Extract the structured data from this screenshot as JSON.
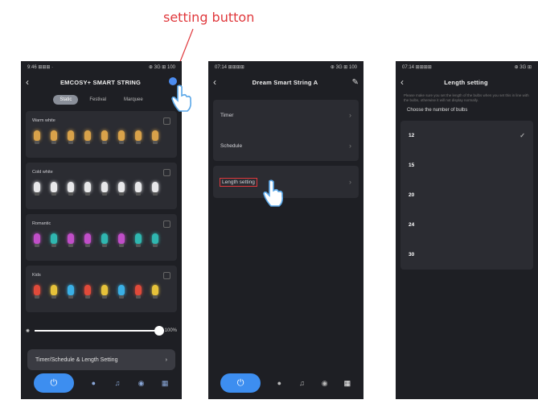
{
  "annotation": {
    "label": "setting button",
    "color": "#e0383c"
  },
  "screen1": {
    "status_left": "9:46 ⊞⊞⊞ ·",
    "status_right": "⊕ 3G ⊞ 100",
    "title": "EMCOSY+ SMART STRING",
    "tabs": [
      "Static",
      "Festival",
      "Marquee"
    ],
    "active_tab": "Static",
    "cards": [
      {
        "label": "Warm white",
        "colors": [
          "#d9a24a",
          "#d9a24a",
          "#d9a24a",
          "#d9a24a",
          "#d9a24a",
          "#d9a24a",
          "#d9a24a",
          "#d9a24a"
        ]
      },
      {
        "label": "Cold white",
        "colors": [
          "#e8e8ea",
          "#e8e8ea",
          "#e8e8ea",
          "#e8e8ea",
          "#e8e8ea",
          "#e8e8ea",
          "#e8e8ea",
          "#e8e8ea"
        ]
      },
      {
        "label": "Romantic",
        "colors": [
          "#c04ec8",
          "#2fb7b0",
          "#c04ec8",
          "#c04ec8",
          "#2fb7b0",
          "#c04ec8",
          "#2fb7b0",
          "#2fb7b0"
        ]
      },
      {
        "label": "Kids",
        "colors": [
          "#e04a3a",
          "#e6c23a",
          "#3ab0e6",
          "#e04a3a",
          "#e6c23a",
          "#3ab0e6",
          "#e04a3a",
          "#e6c23a"
        ]
      }
    ],
    "brightness_value": "100%",
    "bottom_button": "Timer/Schedule & Length Setting",
    "accent": "#3d8ef0"
  },
  "screen2": {
    "status_left": "07:14 ⊞⊞⊞⊞",
    "status_right": "⊕ 3G ⊞ 100",
    "title": "Dream Smart String A",
    "items_group": [
      "Timer",
      "Schedule"
    ],
    "length_item": "Length setting",
    "highlight_color": "#e0383c"
  },
  "screen3": {
    "status_left": "07:14 ⊞⊞⊞⊞",
    "status_right": "⊕ 3G ⊞",
    "title": "Length setting",
    "description": "Please make sure you set the length of the bulbs when you set this in line with the bulbs, otherwise it will not display normally.",
    "prompt": "Choose the number of bulbs",
    "options": [
      "12",
      "15",
      "20",
      "24",
      "30"
    ],
    "selected": "12"
  }
}
